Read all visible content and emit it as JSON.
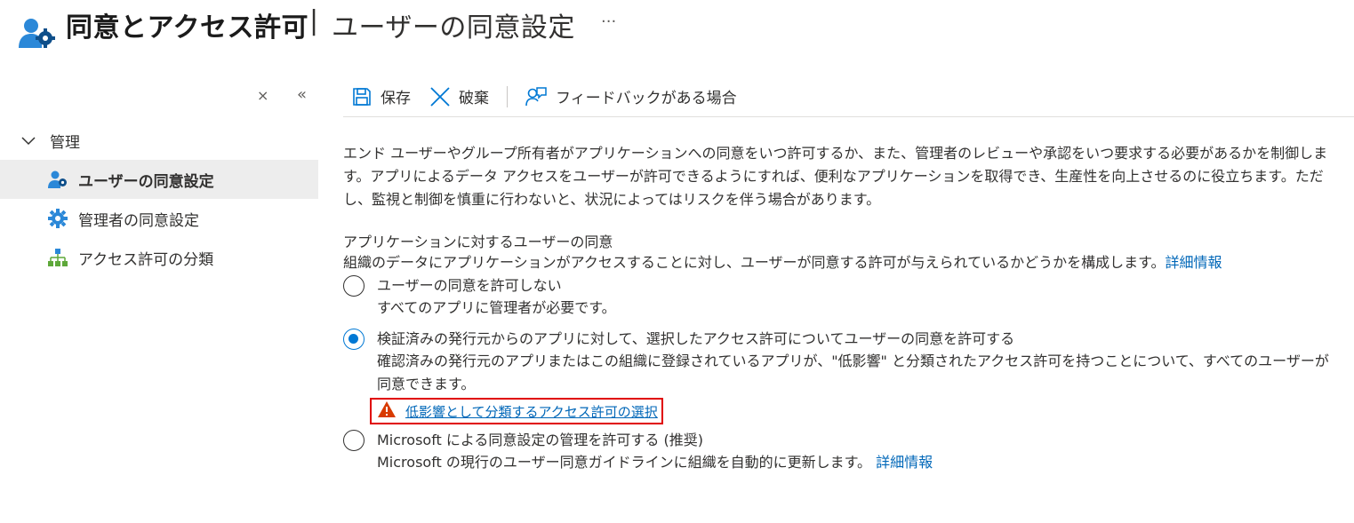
{
  "header": {
    "title": "同意とアクセス許可",
    "separator": "|",
    "subtitle": "ユーザーの同意設定",
    "more": "···"
  },
  "sidebar": {
    "close_label": "×",
    "collapse_label": "«",
    "group_label": "管理",
    "items": [
      {
        "label": "ユーザーの同意設定",
        "icon": "user-settings-icon",
        "active": true
      },
      {
        "label": "管理者の同意設定",
        "icon": "gear-icon",
        "active": false
      },
      {
        "label": "アクセス許可の分類",
        "icon": "hierarchy-icon",
        "active": false
      }
    ]
  },
  "toolbar": {
    "save_label": "保存",
    "discard_label": "破棄",
    "feedback_label": "フィードバックがある場合"
  },
  "main": {
    "description": "エンド ユーザーやグループ所有者がアプリケーションへの同意をいつ許可するか、また、管理者のレビューや承認をいつ要求する必要があるかを制御します。アプリによるデータ アクセスをユーザーが許可できるようにすれば、便利なアプリケーションを取得でき、生産性を向上させるのに役立ちます。ただし、監視と制御を慎重に行わないと、状況によってはリスクを伴う場合があります。",
    "section_title": "アプリケーションに対するユーザーの同意",
    "section_desc": "組織のデータにアプリケーションがアクセスすることに対し、ユーザーが同意する許可が与えられているかどうかを構成します。",
    "section_link": "詳細情報",
    "options": [
      {
        "label": "ユーザーの同意を許可しない",
        "sub": "すべてのアプリに管理者が必要です。",
        "checked": false
      },
      {
        "label": "検証済みの発行元からのアプリに対して、選択したアクセス許可についてユーザーの同意を許可する",
        "sub": "確認済みの発行元のアプリまたはこの組織に登録されているアプリが、\"低影響\" と分類されたアクセス許可を持つことについて、すべてのユーザーが同意できます。",
        "checked": true
      },
      {
        "label": "Microsoft による同意設定の管理を許可する (推奨)",
        "sub": "Microsoft の現行のユーザー同意ガイドラインに組織を自動的に更新します。",
        "sub_link": "詳細情報",
        "checked": false
      }
    ],
    "warning_link": "低影響として分類するアクセス許可の選択"
  },
  "colors": {
    "accent": "#0078d4",
    "link": "#0067b8",
    "warning": "#d83b01",
    "highlight_border": "#e00000"
  }
}
